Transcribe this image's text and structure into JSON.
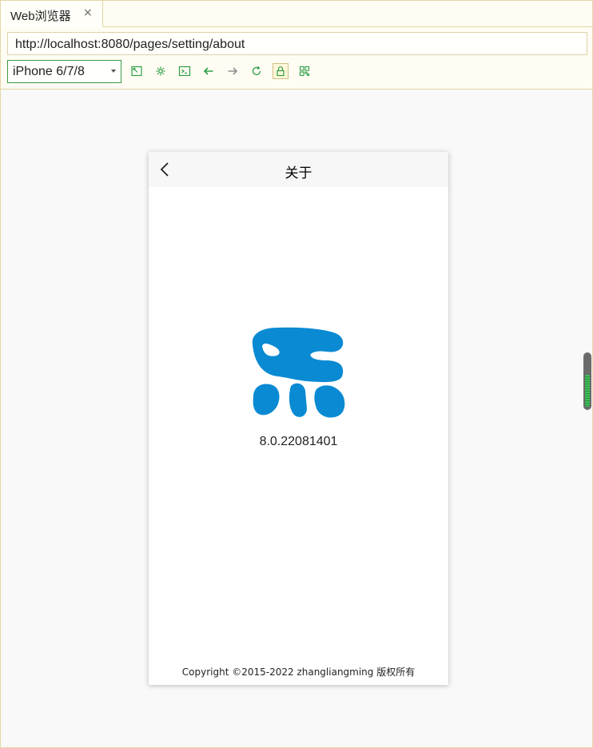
{
  "browser": {
    "tab_title": "Web浏览器",
    "tab_close": "×",
    "url": "http://localhost:8080/pages/setting/about",
    "device": "iPhone 6/7/8",
    "toolbar_icons": [
      "screenshot-icon",
      "settings-gear-icon",
      "console-icon",
      "back-arrow-icon",
      "forward-arrow-icon",
      "reload-icon",
      "lock-icon",
      "qrcode-icon"
    ]
  },
  "page": {
    "title": "关于",
    "version": "8.0.22081401",
    "copyright": "Copyright ©2015-2022 zhangliangming 版权所有",
    "logo_color": "#0a8ad3"
  },
  "colors": {
    "accent_green": "#2e9e47",
    "chrome_bg": "#fffdf3",
    "chrome_border": "#e1d4a3"
  }
}
